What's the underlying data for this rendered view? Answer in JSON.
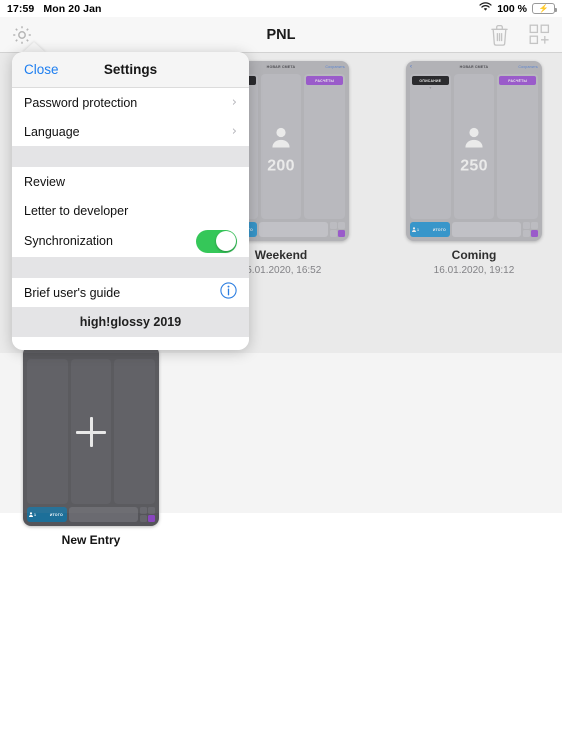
{
  "statusbar": {
    "time": "17:59",
    "date": "Mon 20 Jan",
    "battery_percent": "100 %",
    "wifi_icon": "wifi-icon",
    "battery_icon": "battery-charging-icon"
  },
  "navbar": {
    "title": "PNL",
    "settings_icon": "gear-icon",
    "trash_icon": "trash-icon",
    "add_icon": "grid-add-icon"
  },
  "settings_popover": {
    "close_label": "Close",
    "title": "Settings",
    "group1": [
      {
        "label": "Password protection",
        "accessory": "chevron-right-icon"
      },
      {
        "label": "Language",
        "accessory": "chevron-right-icon"
      }
    ],
    "group2": [
      {
        "label": "Review",
        "accessory": "none"
      },
      {
        "label": "Letter to developer",
        "accessory": "none"
      },
      {
        "label": "Synchronization",
        "accessory": "toggle",
        "toggle_on": true
      }
    ],
    "group3": [
      {
        "label": "Brief user's guide",
        "accessory": "info-icon"
      }
    ],
    "footer": "high!glossy 2019",
    "toggle_on_color": "#35C759",
    "accent_color": "#1D7EF0"
  },
  "cards": [
    {
      "label": "Weekend",
      "date": "15.01.2020, 16:52",
      "value": "200",
      "type": "entry",
      "mini": {
        "back_icon": "chevron-left-icon",
        "title": "НОВАЯ СМЕТА",
        "save": "Сохранить",
        "desc_chip": "ОПИСАНИЕ",
        "calc_chip": "РАСЧЁТЫ",
        "person_count": "1",
        "total_label": "ИТОГО",
        "person_icon": "person-icon"
      }
    },
    {
      "label": "Coming",
      "date": "16.01.2020, 19:12",
      "value": "250",
      "type": "entry",
      "mini": {
        "back_icon": "chevron-left-icon",
        "title": "НОВАЯ СМЕТА",
        "save": "Сохранить",
        "desc_chip": "ОПИСАНИЕ",
        "calc_chip": "РАСЧЁТЫ",
        "person_count": "1",
        "total_label": "ИТОГО",
        "person_icon": "person-icon"
      }
    },
    {
      "label": "New Entry",
      "date": "",
      "value": "",
      "type": "new",
      "mini": {
        "back_icon": "",
        "title": "",
        "save": "",
        "desc_chip": "",
        "calc_chip": "",
        "person_count": "1",
        "total_label": "ИТОГО",
        "person_icon": "plus-icon"
      }
    }
  ]
}
